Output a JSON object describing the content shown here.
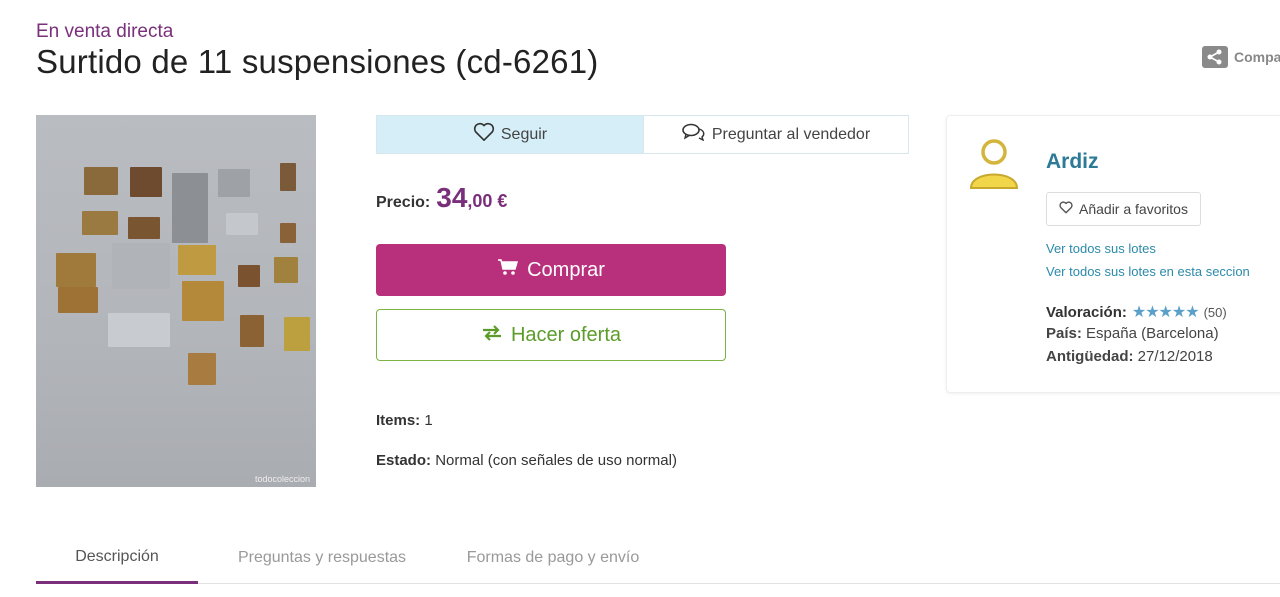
{
  "header": {
    "subtitle": "En venta directa",
    "title": "Surtido de 11 suspensiones (cd-6261)",
    "share_label": "Compa",
    "share_icon": "share-icon"
  },
  "photo": {
    "watermark": "todocoleccion"
  },
  "actions": {
    "follow_label": "Seguir",
    "follow_icon": "heart-icon",
    "ask_label": "Preguntar al vendedor",
    "ask_icon": "chat-bubbles-icon"
  },
  "price": {
    "label": "Precio:",
    "integer": "34",
    "decimal": ",00 €"
  },
  "buttons": {
    "buy_label": "Comprar",
    "buy_icon": "cart-icon",
    "buy_color": "#b8307c",
    "offer_label": "Hacer oferta",
    "offer_icon": "swap-arrows-icon",
    "offer_color": "#5c9c2a"
  },
  "details": {
    "items_label": "Items:",
    "items_value": "1",
    "state_label": "Estado:",
    "state_value": "Normal (con señales de uso normal)"
  },
  "seller": {
    "avatar_icon": "user-avatar-icon",
    "name": "Ardiz",
    "fav_label": "Añadir a favoritos",
    "fav_icon": "heart-outline-icon",
    "link_all": "Ver todos sus lotes",
    "link_section": "Ver todos sus lotes en esta seccion",
    "rating_label": "Valoración:",
    "rating_stars": "★★★★★",
    "rating_count": "(50)",
    "country_label": "País:",
    "country_value": "España (Barcelona)",
    "age_label": "Antigüedad:",
    "age_value": "27/12/2018"
  },
  "tabs": [
    {
      "label": "Descripción",
      "active": true
    },
    {
      "label": "Preguntas y respuestas",
      "active": false
    },
    {
      "label": "Formas de pago y envío",
      "active": false
    }
  ]
}
